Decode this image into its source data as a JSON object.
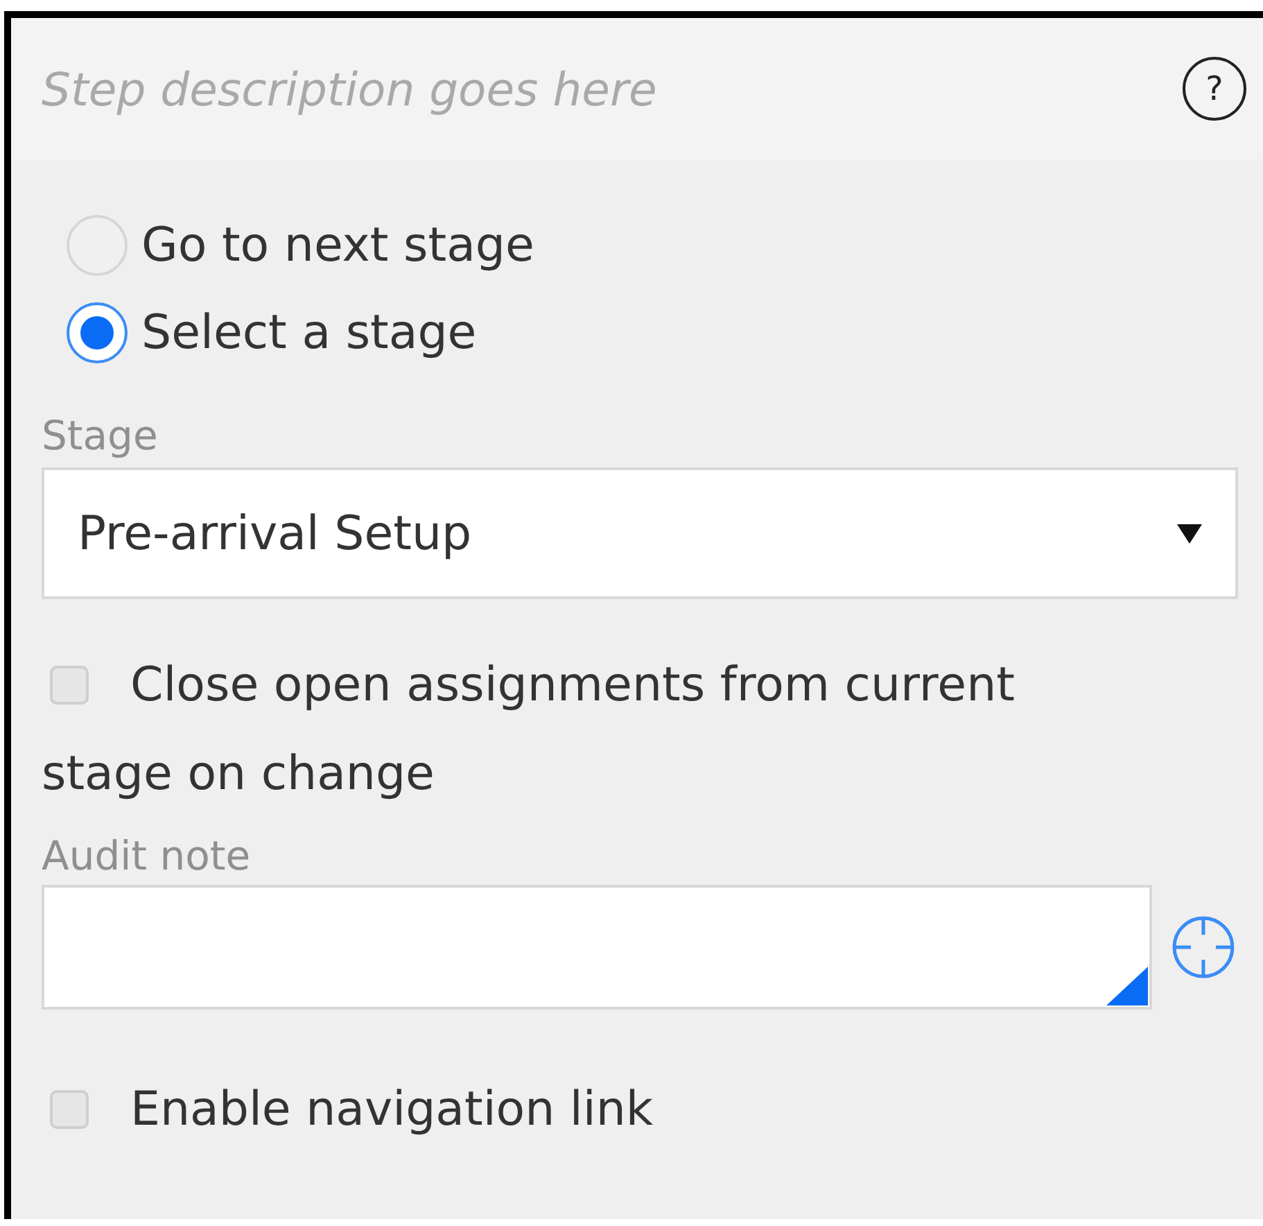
{
  "header": {
    "description": "Step description goes here",
    "help": "?"
  },
  "options": [
    {
      "label": "Go to next stage",
      "selected": false
    },
    {
      "label": "Select a stage",
      "selected": true
    }
  ],
  "stage": {
    "label": "Stage",
    "value": "Pre-arrival Setup"
  },
  "close_assignments": {
    "label": "Close open assignments from current stage on change",
    "checked": false
  },
  "audit_note": {
    "label": "Audit note"
  },
  "navigation_link": {
    "label": "Enable navigation link",
    "checked": false
  }
}
